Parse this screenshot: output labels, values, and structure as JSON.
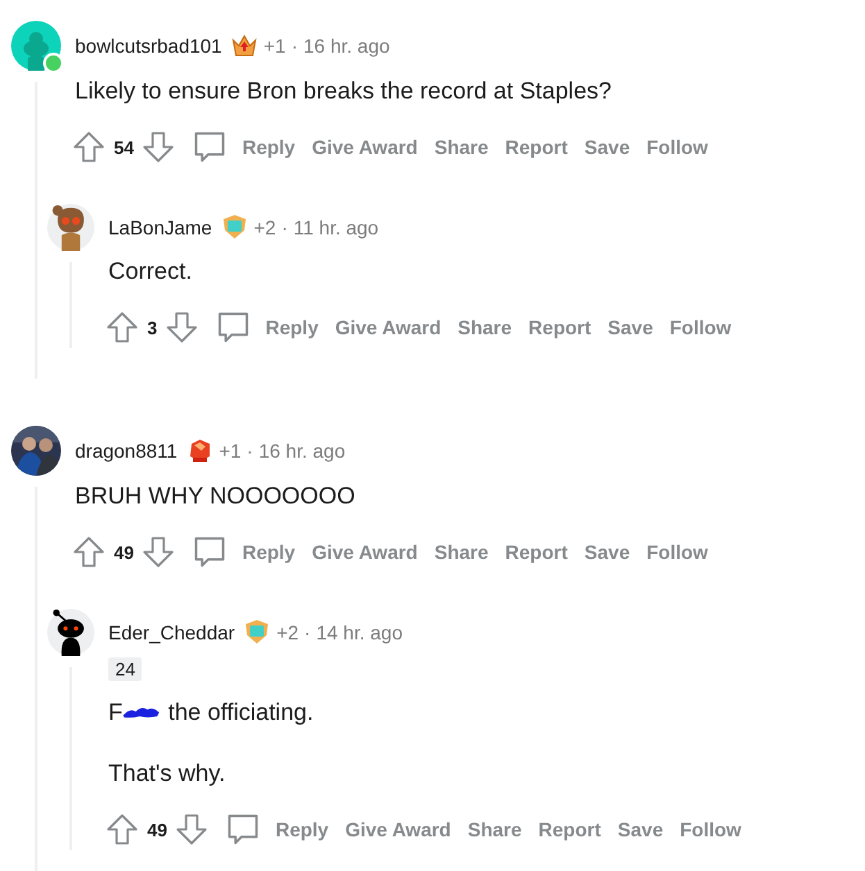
{
  "comments": [
    {
      "avatar": {
        "kind": "snoo-teal"
      },
      "online": true,
      "username": "bowlcutsrbad101",
      "award": {
        "kind": "crown"
      },
      "karma": "+1",
      "separator": "·",
      "time": "16 hr. ago",
      "body": [
        {
          "kind": "text",
          "text": "Likely to ensure Bron breaks the record at Staples?"
        }
      ],
      "score": "54",
      "actions": [
        "Reply",
        "Give Award",
        "Share",
        "Report",
        "Save",
        "Follow"
      ],
      "children": [
        {
          "avatar": {
            "kind": "bear"
          },
          "online": false,
          "username": "LaBonJame",
          "award": {
            "kind": "shield"
          },
          "karma": "+2",
          "separator": "·",
          "time": "11 hr. ago",
          "body": [
            {
              "kind": "text",
              "text": "Correct."
            }
          ],
          "score": "3",
          "actions": [
            "Reply",
            "Give Award",
            "Share",
            "Report",
            "Save",
            "Follow"
          ]
        }
      ]
    },
    {
      "avatar": {
        "kind": "picture"
      },
      "online": false,
      "username": "dragon8811",
      "award": {
        "kind": "gem"
      },
      "karma": "+1",
      "separator": "·",
      "time": "16 hr. ago",
      "body": [
        {
          "kind": "text",
          "text": "BRUH WHY NOOOOOOO"
        }
      ],
      "score": "49",
      "actions": [
        "Reply",
        "Give Award",
        "Share",
        "Report",
        "Save",
        "Follow"
      ],
      "children": [
        {
          "avatar": {
            "kind": "snoo-black"
          },
          "online": false,
          "username": "Eder_Cheddar",
          "award": {
            "kind": "shield"
          },
          "karma": "+2",
          "separator": "·",
          "time": "14 hr. ago",
          "flair": "24",
          "body": [
            {
              "kind": "censored",
              "before": "F",
              "after": "the officiating."
            },
            {
              "kind": "text",
              "text": "That's why."
            }
          ],
          "score": "49",
          "actions": [
            "Reply",
            "Give Award",
            "Share",
            "Report",
            "Save",
            "Follow"
          ]
        }
      ]
    }
  ]
}
